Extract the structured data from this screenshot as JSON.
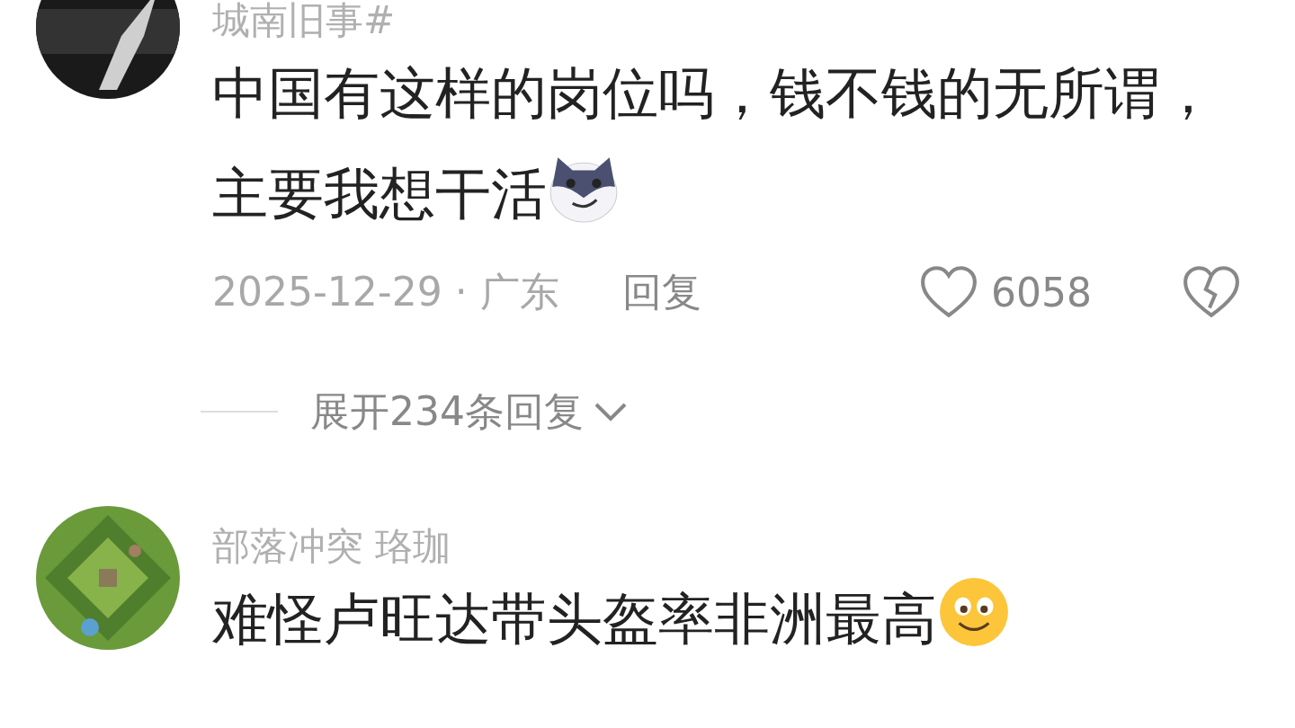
{
  "comments": [
    {
      "username": "城南旧事#",
      "text": "中国有这样的岗位吗，钱不钱的无所谓，主要我想干活",
      "emoji": {
        "kind": "wolf"
      },
      "meta": {
        "date": "2025-12-29 · 广东",
        "reply": "回复",
        "likes": "6058"
      },
      "expand": "展开234条回复"
    },
    {
      "username": "部落冲突 珞珈",
      "text": "难怪卢旺达带头盔率非洲最高",
      "emoji": {
        "kind": "smile"
      }
    }
  ]
}
